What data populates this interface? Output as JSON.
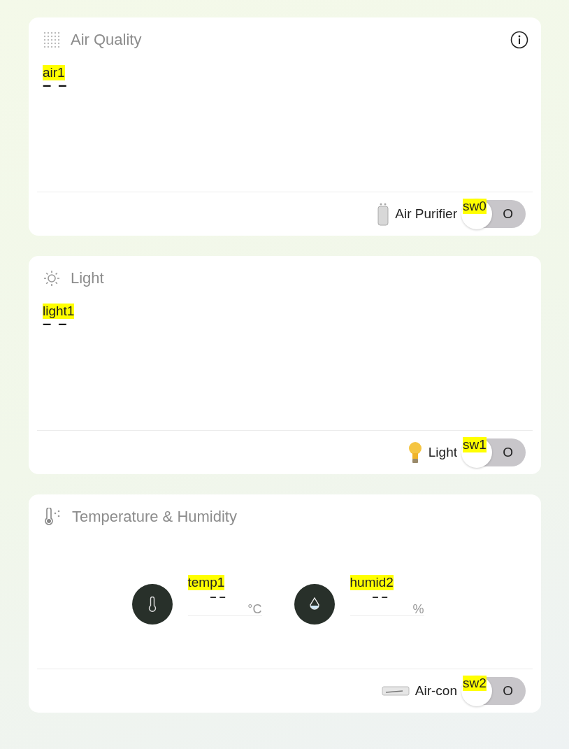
{
  "cards": [
    {
      "kind": "air",
      "title": "Air Quality",
      "info": true,
      "tag": "air1",
      "value": "– –",
      "device": {
        "kind": "purifier",
        "name": "Air Purifier",
        "switch": {
          "tag": "sw0",
          "label": "O",
          "on": false
        }
      }
    },
    {
      "kind": "light",
      "title": "Light",
      "info": false,
      "tag": "light1",
      "value": "– –",
      "device": {
        "kind": "bulb",
        "name": "Light",
        "switch": {
          "tag": "sw1",
          "label": "O",
          "on": false
        }
      }
    },
    {
      "kind": "climate",
      "title": "Temperature & Humidity",
      "info": false,
      "readings": [
        {
          "kind": "temperature",
          "tag": "temp1",
          "value": "– –",
          "unit": "°C"
        },
        {
          "kind": "humidity",
          "tag": "humid2",
          "value": "– –",
          "unit": "%"
        }
      ],
      "device": {
        "kind": "aircon",
        "name": "Air-con",
        "switch": {
          "tag": "sw2",
          "label": "O",
          "on": false
        }
      }
    }
  ]
}
